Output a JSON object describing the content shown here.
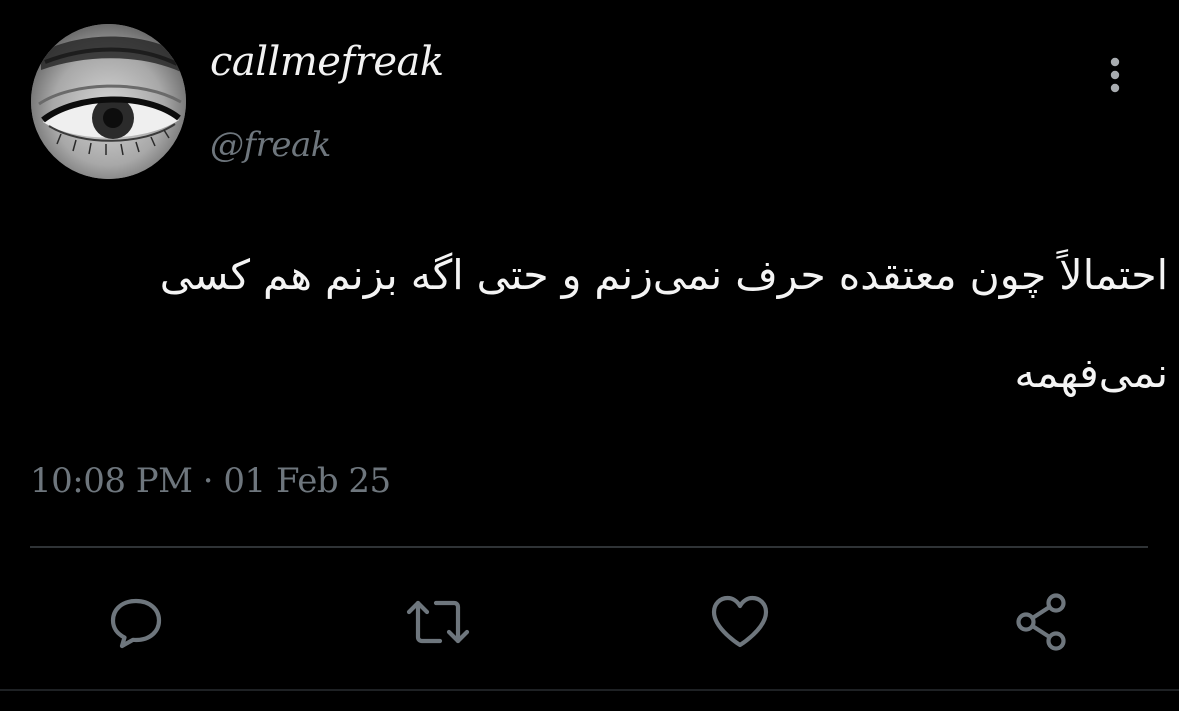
{
  "user": {
    "display_name": "callmefreak",
    "handle": "@freak"
  },
  "tweet": {
    "text": "احتمالاً چون معتقده حرف نمی‌زنم و حتی اگه بزنم هم کسی نمی‌فهمه",
    "timestamp": "10:08 PM · 01 Feb 25"
  },
  "actions": [
    {
      "name": "reply",
      "icon": "speech-bubble-icon"
    },
    {
      "name": "retweet",
      "icon": "retweet-icon"
    },
    {
      "name": "like",
      "icon": "heart-icon"
    },
    {
      "name": "share",
      "icon": "share-icon"
    }
  ],
  "colors": {
    "background": "#000000",
    "text": "#f4f4f4",
    "secondary": "#6e767d",
    "divider": "#2f3336"
  }
}
